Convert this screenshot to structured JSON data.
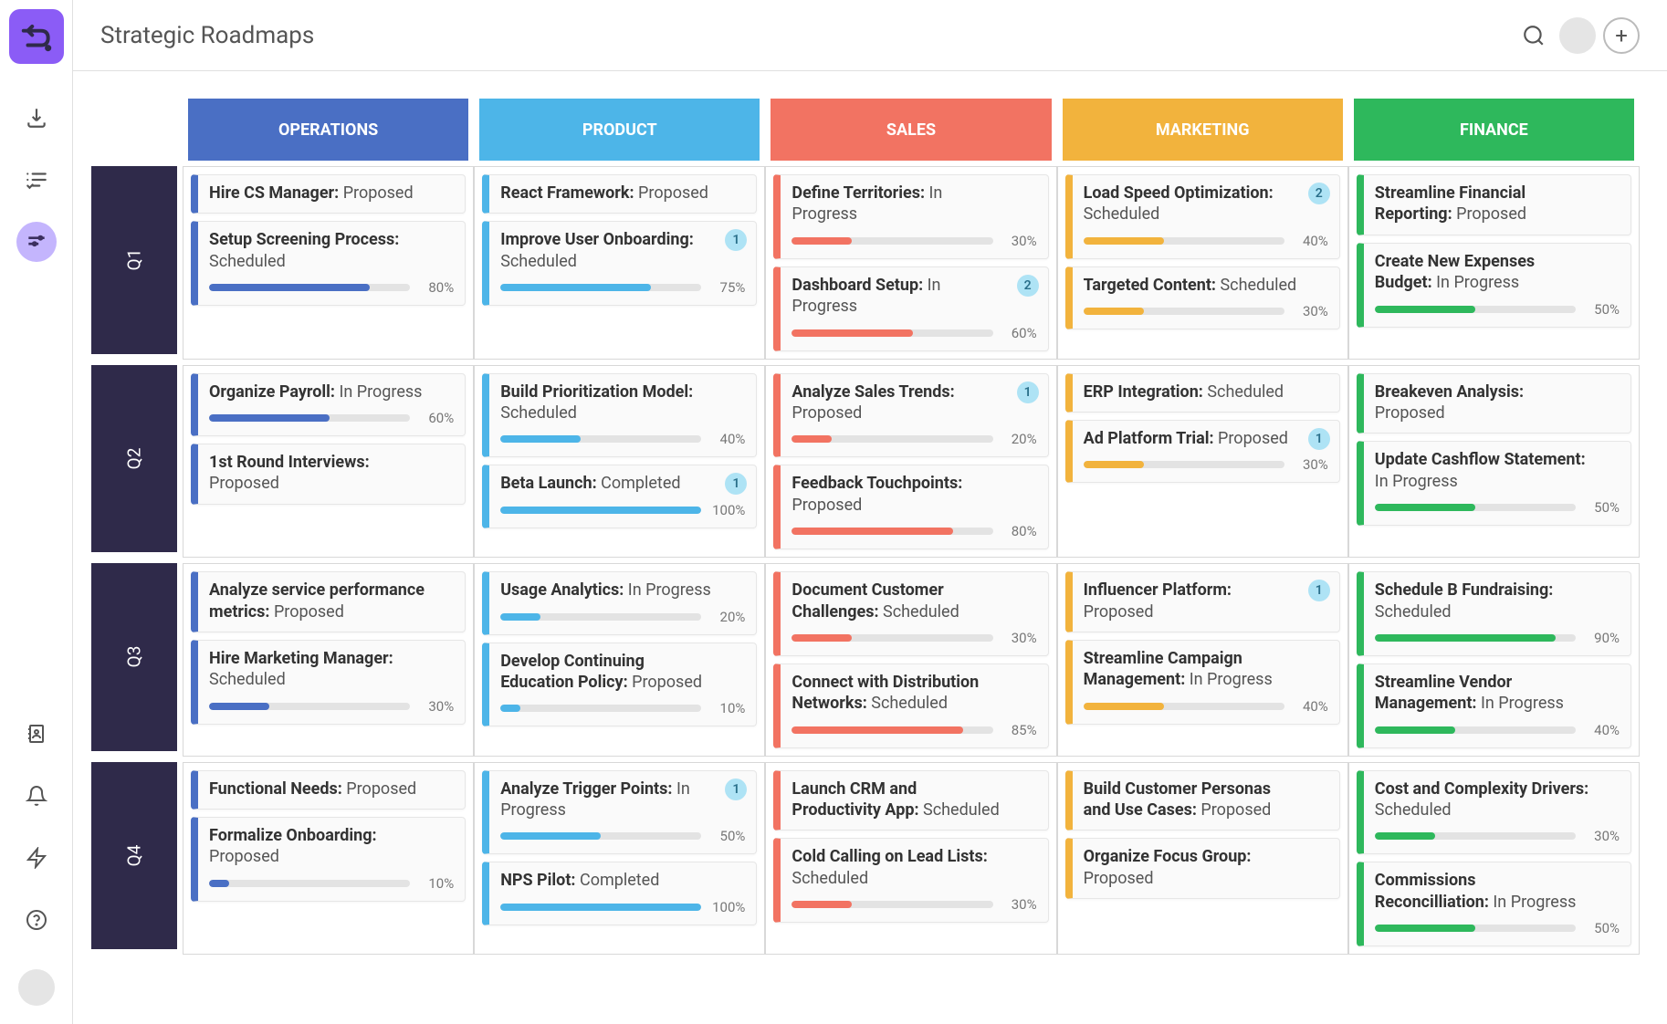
{
  "page_title": "Strategic Roadmaps",
  "columns": [
    {
      "key": "operations",
      "label": "OPERATIONS"
    },
    {
      "key": "product",
      "label": "PRODUCT"
    },
    {
      "key": "sales",
      "label": "SALES"
    },
    {
      "key": "marketing",
      "label": "MARKETING"
    },
    {
      "key": "finance",
      "label": "FINANCE"
    }
  ],
  "rows": [
    {
      "key": "q1",
      "label": "Q1"
    },
    {
      "key": "q2",
      "label": "Q2"
    },
    {
      "key": "q3",
      "label": "Q3"
    },
    {
      "key": "q4",
      "label": "Q4"
    }
  ],
  "cards": {
    "q1": {
      "operations": [
        {
          "title": "Hire CS Manager:",
          "status": "Proposed"
        },
        {
          "title": "Setup Screening Process:",
          "status": "Scheduled",
          "progress": 80
        }
      ],
      "product": [
        {
          "title": "React Framework:",
          "status": "Proposed"
        },
        {
          "title": "Improve User Onboarding:",
          "status": "Scheduled",
          "progress": 75,
          "badge": 1
        }
      ],
      "sales": [
        {
          "title": "Define Territories:",
          "status": "In Progress",
          "progress": 30
        },
        {
          "title": "Dashboard Setup:",
          "status": "In Progress",
          "progress": 60,
          "badge": 2
        }
      ],
      "marketing": [
        {
          "title": "Load Speed Optimization:",
          "status": "Scheduled",
          "progress": 40,
          "badge": 2
        },
        {
          "title": "Targeted Content:",
          "status": "Scheduled",
          "progress": 30
        }
      ],
      "finance": [
        {
          "title": "Streamline Financial Reporting:",
          "status": "Proposed"
        },
        {
          "title": "Create New Expenses Budget:",
          "status": "In Progress",
          "progress": 50
        }
      ]
    },
    "q2": {
      "operations": [
        {
          "title": "Organize Payroll:",
          "status": "In Progress",
          "progress": 60
        },
        {
          "title": "1st Round Interviews:",
          "status": "Proposed"
        }
      ],
      "product": [
        {
          "title": "Build Prioritization Model:",
          "status": "Scheduled",
          "progress": 40
        },
        {
          "title": "Beta Launch:",
          "status": "Completed",
          "progress": 100,
          "badge": 1
        }
      ],
      "sales": [
        {
          "title": "Analyze Sales Trends:",
          "status": "Proposed",
          "progress": 20,
          "badge": 1
        },
        {
          "title": "Feedback Touchpoints:",
          "status": "Proposed",
          "progress": 80
        }
      ],
      "marketing": [
        {
          "title": "ERP Integration:",
          "status": "Scheduled"
        },
        {
          "title": "Ad Platform Trial:",
          "status": "Proposed",
          "progress": 30,
          "badge": 1
        }
      ],
      "finance": [
        {
          "title": "Breakeven Analysis:",
          "status": "Proposed"
        },
        {
          "title": "Update Cashflow Statement:",
          "status": "In Progress",
          "progress": 50
        }
      ]
    },
    "q3": {
      "operations": [
        {
          "title": "Analyze service performance metrics:",
          "status": "Proposed"
        },
        {
          "title": "Hire Marketing Manager:",
          "status": "Scheduled",
          "progress": 30
        }
      ],
      "product": [
        {
          "title": "Usage Analytics:",
          "status": "In Progress",
          "progress": 20
        },
        {
          "title": "Develop Continuing Education Policy:",
          "status": "Proposed",
          "progress": 10
        }
      ],
      "sales": [
        {
          "title": "Document Customer Challenges:",
          "status": "Scheduled",
          "progress": 30
        },
        {
          "title": "Connect with Distribution Networks:",
          "status": "Scheduled",
          "progress": 85
        }
      ],
      "marketing": [
        {
          "title": "Influencer Platform:",
          "status": "Proposed",
          "badge": 1
        },
        {
          "title": "Streamline Campaign Management:",
          "status": "In Progress",
          "progress": 40
        }
      ],
      "finance": [
        {
          "title": "Schedule B Fundraising:",
          "status": "Scheduled",
          "progress": 90
        },
        {
          "title": "Streamline Vendor Management:",
          "status": "In Progress",
          "progress": 40
        }
      ]
    },
    "q4": {
      "operations": [
        {
          "title": "Functional Needs:",
          "status": "Proposed"
        },
        {
          "title": "Formalize Onboarding:",
          "status": "Proposed",
          "progress": 10
        }
      ],
      "product": [
        {
          "title": "Analyze Trigger Points:",
          "status": "In Progress",
          "progress": 50,
          "badge": 1
        },
        {
          "title": "NPS Pilot: ",
          "status": "Completed",
          "progress": 100
        }
      ],
      "sales": [
        {
          "title": "Launch CRM and Productivity App:",
          "status": "Scheduled"
        },
        {
          "title": "Cold Calling on Lead Lists:",
          "status": "Scheduled",
          "progress": 30
        }
      ],
      "marketing": [
        {
          "title": "Build Customer Personas and Use Cases:",
          "status": "Proposed"
        },
        {
          "title": "Organize Focus Group:",
          "status": "Proposed"
        }
      ],
      "finance": [
        {
          "title": "Cost and Complexity Drivers:",
          "status": "Scheduled",
          "progress": 30
        },
        {
          "title": "Commissions Reconcilliation:",
          "status": "In Progress",
          "progress": 50
        }
      ]
    }
  }
}
